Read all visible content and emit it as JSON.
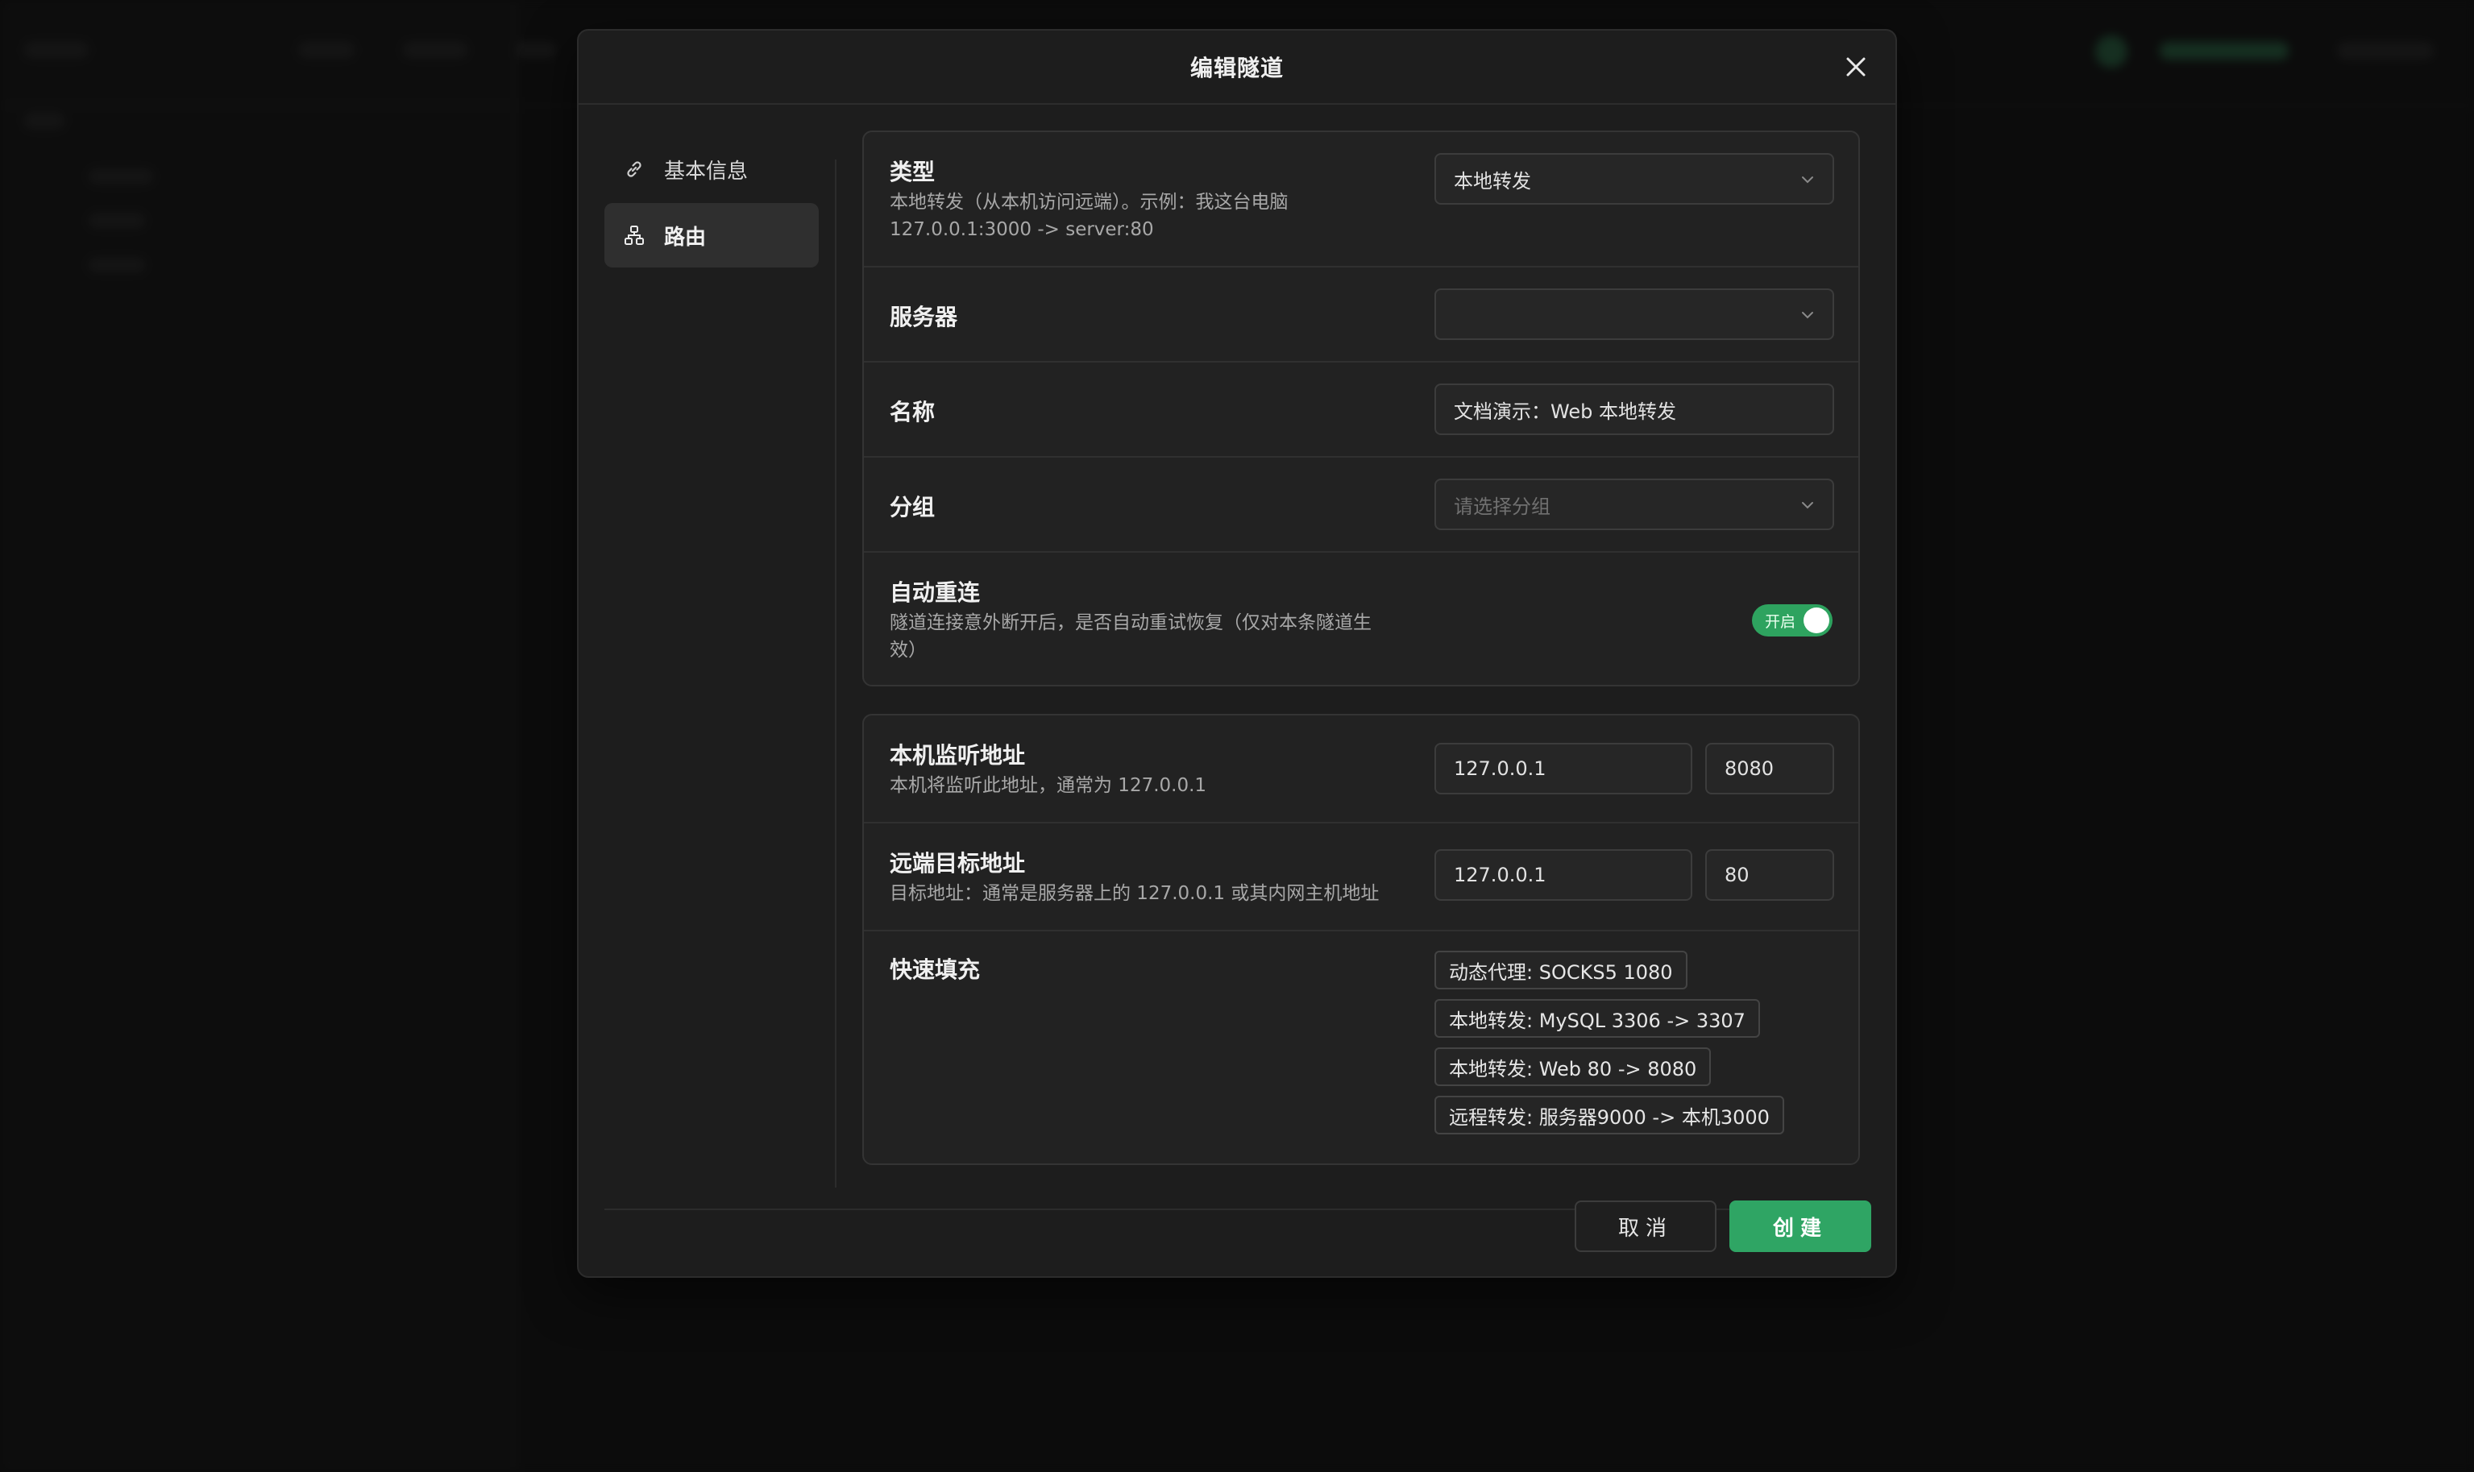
{
  "modal": {
    "title": "编辑隧道"
  },
  "nav": {
    "items": [
      {
        "label": "基本信息"
      },
      {
        "label": "路由"
      }
    ]
  },
  "fields": {
    "type": {
      "label": "类型",
      "desc_line1": "本地转发（从本机访问远端）。示例：我这台电脑",
      "desc_line2": "127.0.0.1:3000 -> server:80",
      "value": "本地转发"
    },
    "server": {
      "label": "服务器",
      "value": ""
    },
    "name": {
      "label": "名称",
      "value": "文档演示：Web 本地转发"
    },
    "group": {
      "label": "分组",
      "placeholder": "请选择分组"
    },
    "auto_reconnect": {
      "label": "自动重连",
      "desc_line1": "隧道连接意外断开后，是否自动重试恢复（仅对本条隧道生",
      "desc_line2": "效）",
      "toggle_text": "开启",
      "enabled": true
    },
    "local_listen": {
      "label": "本机监听地址",
      "desc": "本机将监听此地址，通常为 127.0.0.1",
      "host": "127.0.0.1",
      "port": "8080"
    },
    "remote_target": {
      "label": "远端目标地址",
      "desc": "目标地址：通常是服务器上的 127.0.0.1 或其内网主机地址",
      "host": "127.0.0.1",
      "port": "80"
    },
    "quick_fill": {
      "label": "快速填充",
      "chips": [
        "动态代理: SOCKS5 1080",
        "本地转发: MySQL 3306 -> 3307",
        "本地转发: Web 80 -> 8080",
        "远程转发: 服务器9000 -> 本机3000"
      ]
    }
  },
  "footer": {
    "cancel_label": "取消",
    "create_label": "创建"
  },
  "colors": {
    "accent": "#2fa564",
    "toggle_on": "#2ea35f"
  }
}
